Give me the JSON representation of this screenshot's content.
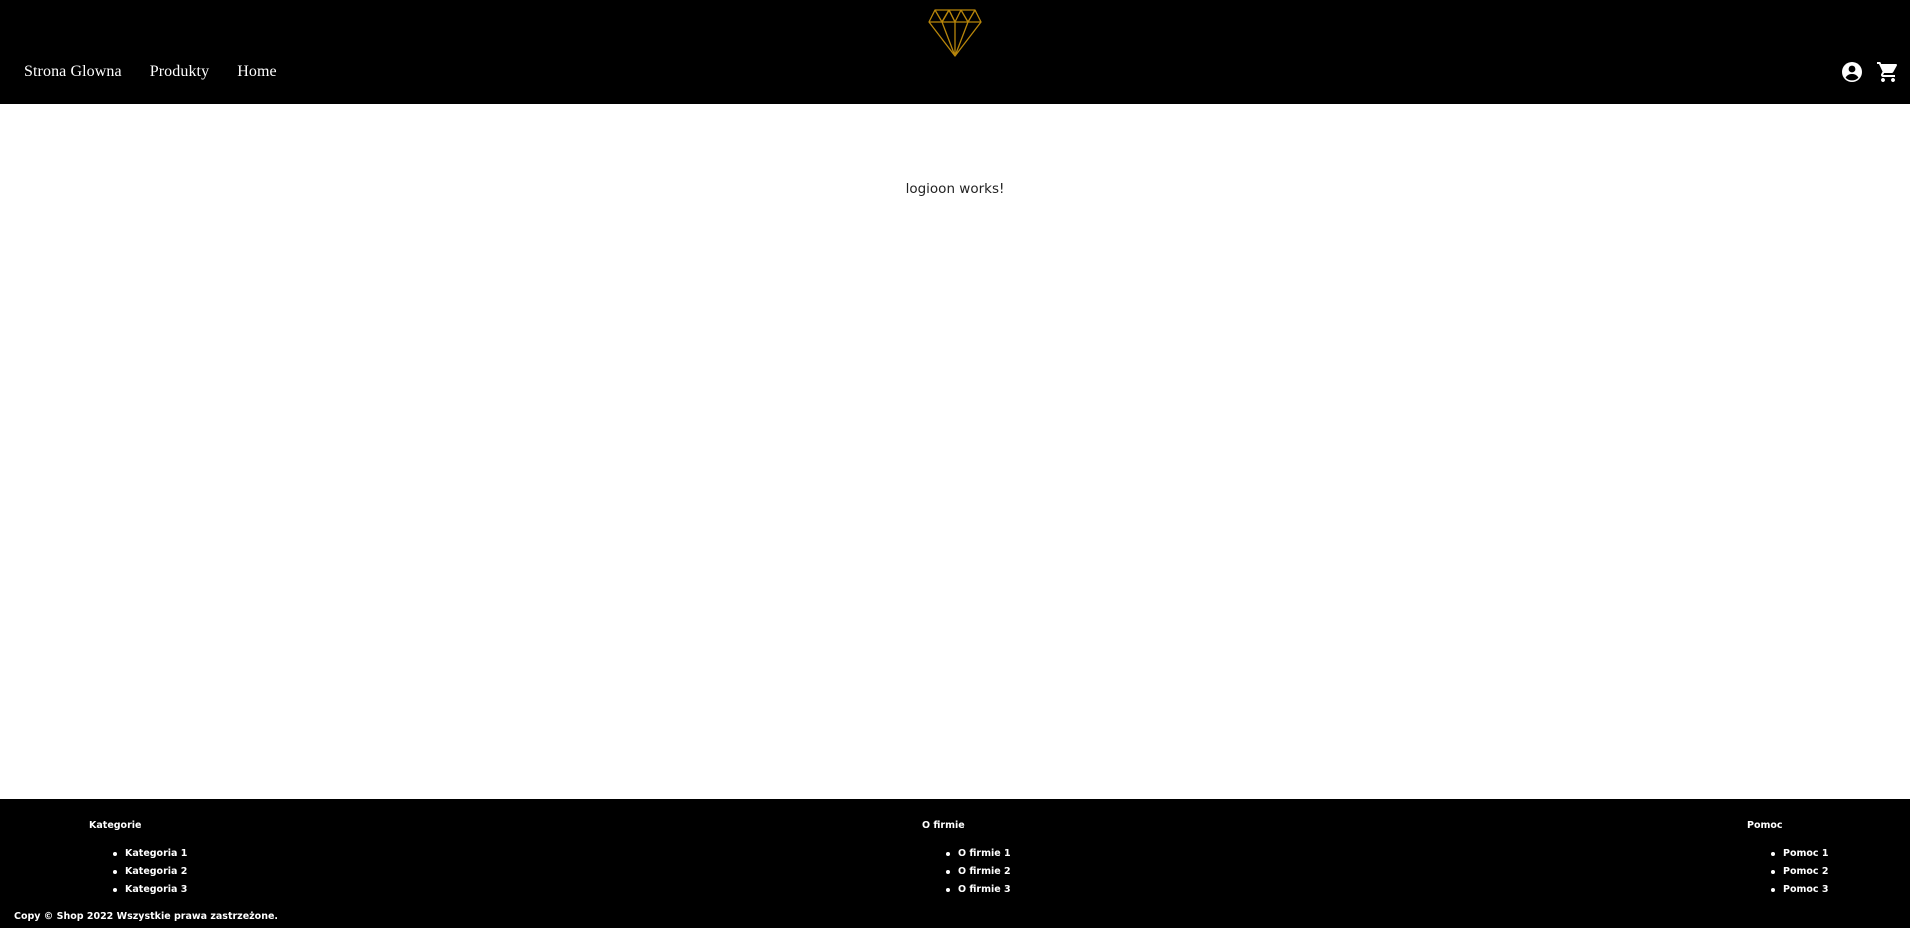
{
  "colors": {
    "header_bg": "#000000",
    "footer_bg": "#000000",
    "logo_gold": "#b8860b",
    "text_light": "#ffffff",
    "body_text": "#222222"
  },
  "header": {
    "logo_icon": "diamond-icon",
    "nav": [
      {
        "label": "Strona Glowna"
      },
      {
        "label": "Produkty"
      },
      {
        "label": "Home"
      }
    ],
    "icons": {
      "account": "account-circle-icon",
      "cart": "shopping-cart-icon"
    }
  },
  "main": {
    "message": "logioon works!"
  },
  "footer": {
    "columns": [
      {
        "title": "Kategorie",
        "items": [
          "Kategoria 1",
          "Kategoria 2",
          "Kategoria 3"
        ]
      },
      {
        "title": "O firmie",
        "items": [
          "O firmie 1",
          "O firmie 2",
          "O firmie 3"
        ]
      },
      {
        "title": "Pomoc",
        "items": [
          "Pomoc 1",
          "Pomoc 2",
          "Pomoc 3"
        ]
      }
    ],
    "copyright": "Copy © Shop 2022 Wszystkie prawa zastrzeżone."
  }
}
